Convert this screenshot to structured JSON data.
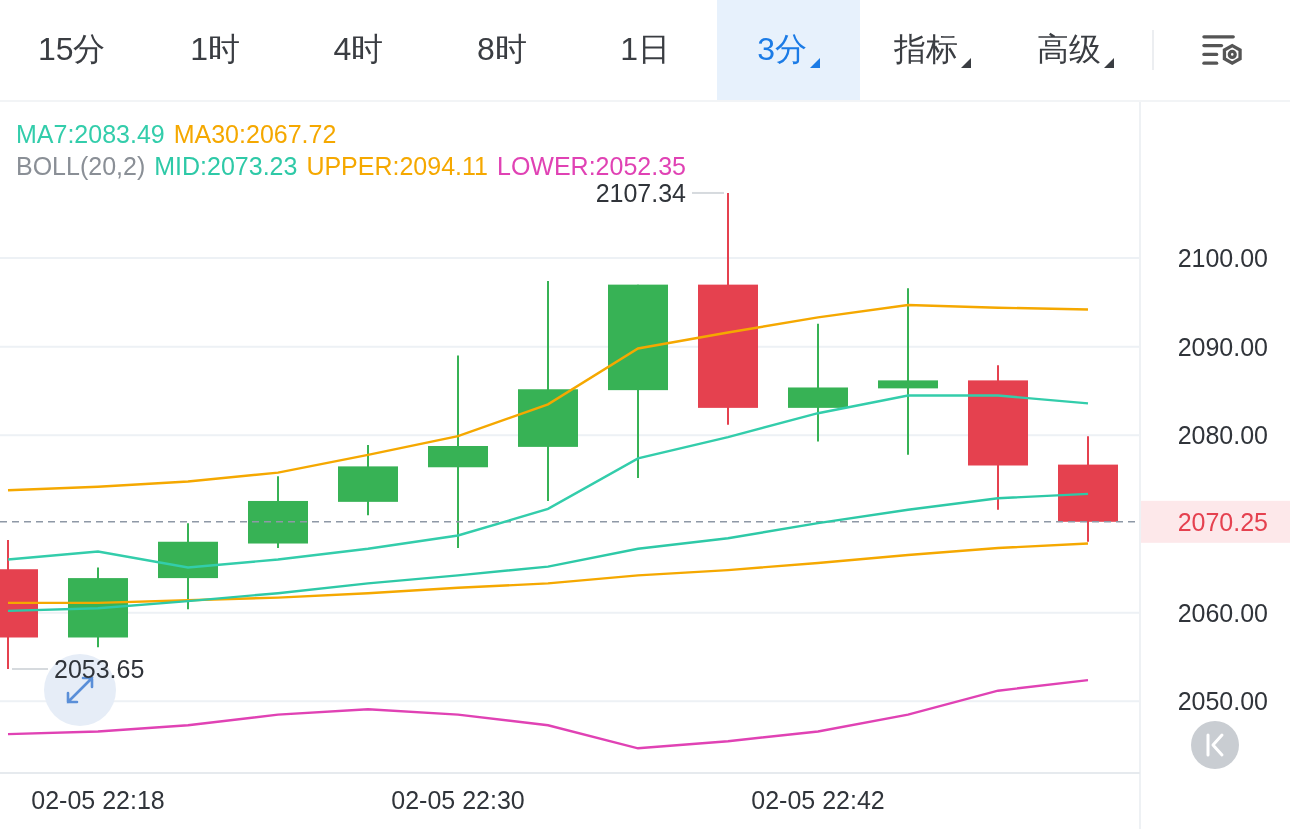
{
  "tabs": [
    {
      "label": "15分",
      "selected": false,
      "has_menu": false
    },
    {
      "label": "1时",
      "selected": false,
      "has_menu": false
    },
    {
      "label": "4时",
      "selected": false,
      "has_menu": false
    },
    {
      "label": "8时",
      "selected": false,
      "has_menu": false
    },
    {
      "label": "1日",
      "selected": false,
      "has_menu": false
    },
    {
      "label": "3分",
      "selected": true,
      "has_menu": true
    },
    {
      "label": "指标",
      "selected": false,
      "has_menu": true
    },
    {
      "label": "高级",
      "selected": false,
      "has_menu": true
    }
  ],
  "boll_label": {
    "text": "BOLL(20,2)",
    "color": "#8a8f96"
  },
  "chart": {
    "chart_data": {
      "type": "line",
      "categories": [
        null,
        "02-05 22:18",
        null,
        null,
        null,
        "02-05 22:30",
        null,
        null,
        null,
        "02-05 22:42",
        null,
        null,
        null
      ],
      "ylim": [
        2035.6,
        2117.6
      ],
      "yticks": [
        {
          "value": 2050,
          "label": "2050.00"
        },
        {
          "value": 2060,
          "label": "2060.00"
        },
        {
          "value": 2080,
          "label": "2080.00"
        },
        {
          "value": 2090,
          "label": "2090.00"
        },
        {
          "value": 2100,
          "label": "2100.00"
        }
      ],
      "series": [
        {
          "name": "MA7:2083.49",
          "color": "#33cdab",
          "values": [
            2066.0,
            2066.9,
            2065.1,
            2066.0,
            2067.2,
            2068.7,
            2071.7,
            2077.4,
            2079.8,
            2082.5,
            2084.5,
            2084.5,
            2083.6
          ]
        },
        {
          "name": "MA30:2067.72",
          "color": "#f5a800",
          "values": [
            2061.1,
            2061.1,
            2061.4,
            2061.7,
            2062.2,
            2062.8,
            2063.3,
            2064.2,
            2064.8,
            2065.6,
            2066.5,
            2067.3,
            2067.8
          ]
        },
        {
          "name": "MID:2073.23",
          "color": "#2ec9a7",
          "values": [
            2060.2,
            2060.5,
            2061.3,
            2062.2,
            2063.3,
            2064.2,
            2065.2,
            2067.2,
            2068.4,
            2070.1,
            2071.6,
            2072.9,
            2073.4
          ]
        },
        {
          "name": "UPPER:2094.11",
          "color": "#f5a800",
          "values": [
            2073.8,
            2074.2,
            2074.8,
            2075.8,
            2077.8,
            2079.9,
            2083.5,
            2089.8,
            2091.6,
            2093.3,
            2094.7,
            2094.4,
            2094.2
          ]
        },
        {
          "name": "LOWER:2052.35",
          "color": "#e042b4",
          "values": [
            2046.3,
            2046.6,
            2047.3,
            2048.5,
            2049.1,
            2048.5,
            2047.3,
            2044.7,
            2045.5,
            2046.6,
            2048.5,
            2051.2,
            2052.4
          ]
        }
      ],
      "grid": true,
      "ref_lines": [
        {
          "axis": "y",
          "value": 2070.25,
          "label": "2070.25"
        }
      ],
      "annotations": [
        "2107.34",
        "2053.65"
      ]
    }
  }
}
